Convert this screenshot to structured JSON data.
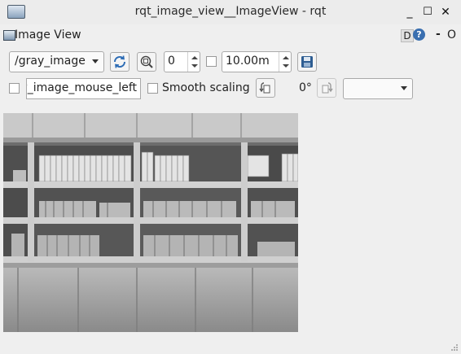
{
  "window": {
    "title": "rqt_image_view__ImageView - rqt",
    "minimize": "_",
    "maximize": "☐",
    "close": "✕"
  },
  "pane": {
    "title": "Image View",
    "d_label": "D",
    "help_label": "?",
    "dash_label": "-",
    "o_label": "O"
  },
  "toolbar": {
    "topic": "/gray_image",
    "zoom_value": "0",
    "rate_value": "10.00m",
    "mouse_topic": "y_image_mouse_left",
    "smooth_label": "Smooth scaling",
    "rotation": "0°",
    "extra_select": ""
  },
  "icons": {
    "refresh": "refresh-icon",
    "zoom": "zoom-fit-icon",
    "save": "save-icon",
    "rotate_left": "rotate-left-icon",
    "rotate_right": "rotate-right-icon"
  }
}
